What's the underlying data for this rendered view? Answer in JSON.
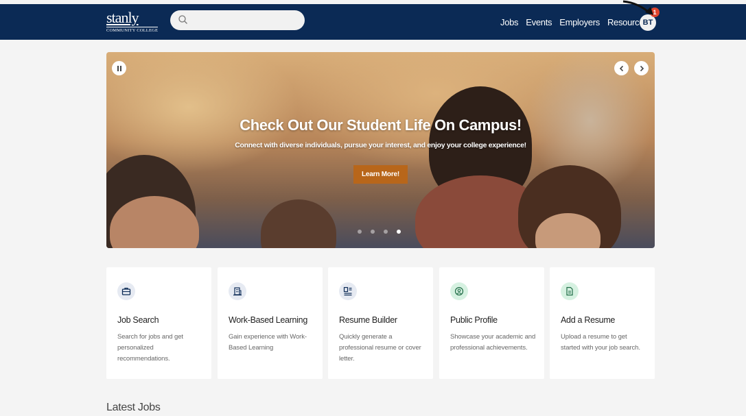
{
  "header": {
    "logo_word": "stanly",
    "logo_sub": "COMMUNITY COLLEGE",
    "search_placeholder": "",
    "nav": [
      "Jobs",
      "Events",
      "Employers",
      "Resources"
    ],
    "avatar_initials": "BT",
    "notification_count": "1"
  },
  "hero": {
    "title": "Check Out Our Student Life On Campus!",
    "subtitle": "Connect with diverse individuals, pursue your interest, and enjoy your college experience!",
    "button_label": "Learn More!",
    "slide_count": 4,
    "active_slide": 4
  },
  "cards": [
    {
      "title": "Job Search",
      "desc": "Search for jobs and get personalized recommendations.",
      "icon": "briefcase-icon",
      "icon_bg": "#e6eaf2"
    },
    {
      "title": "Work-Based Learning",
      "desc": "Gain experience with Work-Based Learning",
      "icon": "building-icon",
      "icon_bg": "#e6eaf2"
    },
    {
      "title": "Resume Builder",
      "desc": "Quickly generate a professional resume or cover letter.",
      "icon": "resume-builder-icon",
      "icon_bg": "#e6eaf2"
    },
    {
      "title": "Public Profile",
      "desc": "Showcase your academic and professional achievements.",
      "icon": "profile-icon",
      "icon_bg": "#d6f1e1"
    },
    {
      "title": "Add a Resume",
      "desc": "Upload a resume to get started with your job search.",
      "icon": "document-icon",
      "icon_bg": "#d6f1e1"
    }
  ],
  "latest_jobs_heading": "Latest Jobs",
  "colors": {
    "header_bg": "#0b2a55",
    "hero_button": "#b8661a",
    "badge": "#e0452e"
  }
}
